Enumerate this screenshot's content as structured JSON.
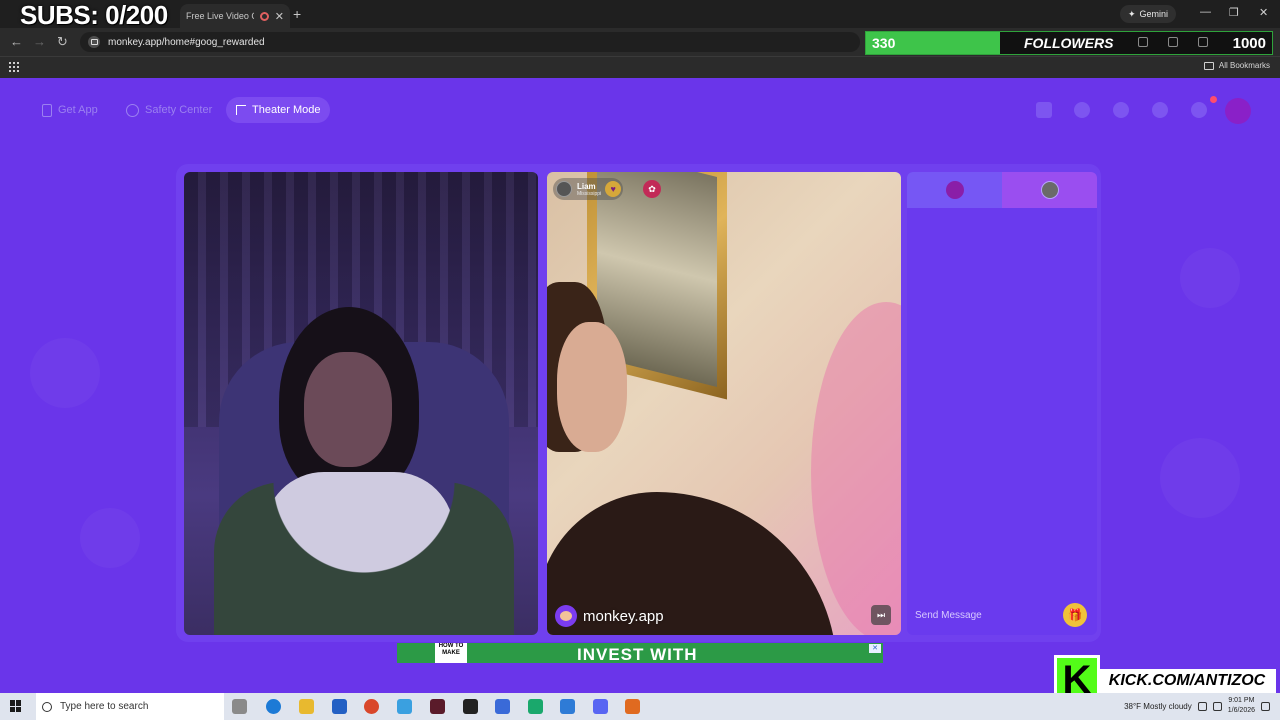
{
  "overlay": {
    "subs": "SUBS: 0/200",
    "followers_current": "330",
    "followers_label": "FOLLOWERS",
    "followers_goal": "1000",
    "followers_progress": 0.33,
    "kick_letter": "K",
    "kick_url": "KICK.COM/ANTIZOC"
  },
  "browser": {
    "tab_title": "Free Live Video Chat",
    "tab_close": "✕",
    "new_tab": "+",
    "gemini_label": "Gemini",
    "url": "monkey.app/home#goog_rewarded",
    "all_bookmarks": "All Bookmarks",
    "win_min": "—",
    "win_max": "❐",
    "win_close": "✕",
    "back": "←",
    "forward": "→",
    "reload": "↻"
  },
  "nav": {
    "get_app": "Get App",
    "safety_center": "Safety Center",
    "theater_mode": "Theater Mode"
  },
  "call": {
    "peer_name": "Liam",
    "peer_location": "Mississippi",
    "heart_glyph": "♥",
    "gift_glyph": "✿",
    "watermark": "monkey.app",
    "skip_glyph": "⏭"
  },
  "chat": {
    "placeholder": "Send Message",
    "gift_glyph": "🎁"
  },
  "ad": {
    "logo_text": "HOW TO MAKE",
    "headline": "INVEST WITH",
    "close_glyph": "✕"
  },
  "taskbar": {
    "search_placeholder": "Type here to search",
    "weather": "38°F Mostly cloudy",
    "time": "9:01 PM",
    "date": "1/6/2026"
  },
  "colors": {
    "page_bg": "#6a35ea",
    "followers_green": "#3ec44a",
    "kick_green": "#53fc18"
  }
}
